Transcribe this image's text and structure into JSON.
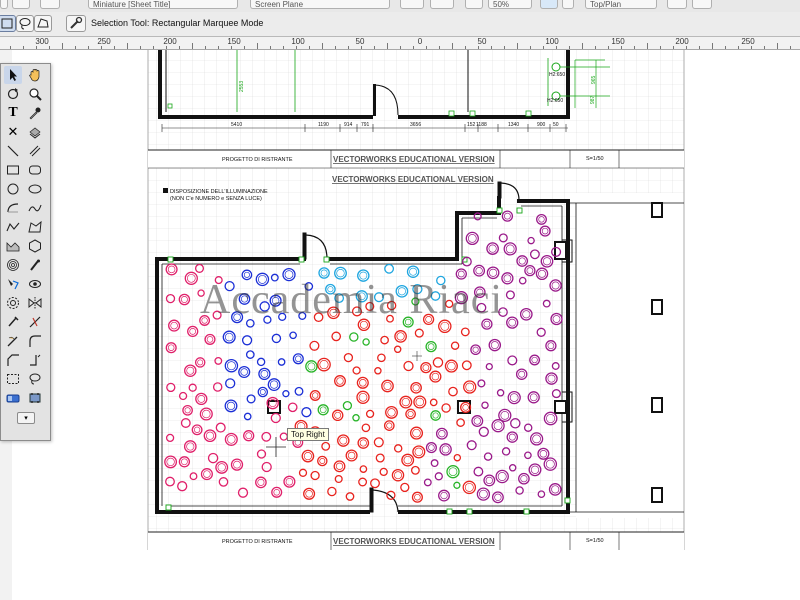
{
  "top_toolbar": {
    "layer_selector": "Miniature [Sheet Title]",
    "plane_selector": "Screen Plane",
    "zoom": "50%",
    "view_selector": "Top/Plan"
  },
  "mode_bar": {
    "tool_hint": "Selection Tool: Rectangular Marquee Mode"
  },
  "ruler": {
    "labels": [
      "300",
      "250",
      "200",
      "150",
      "100",
      "50",
      "0",
      "50",
      "100",
      "150",
      "200",
      "250"
    ]
  },
  "drawing": {
    "upper_dimensions": [
      "5410",
      "1190",
      "914",
      "791",
      "3656",
      "152",
      "1188",
      "1340",
      "900",
      "50"
    ],
    "upper_vertical_dim": "2553",
    "right_dims": [
      "H2:650",
      "965",
      "H2:650",
      "987"
    ],
    "title_block_left": "PROGETTO DI RISTRANTE",
    "title_block_scale": "S=1/50",
    "educational_banner": "VECTORWORKS EDUCATIONAL VERSION",
    "legend_title": "DISPOSIZIONE DELL'ILLUMINAZIONE",
    "legend_subtitle": "(NON C'e NUMERO e SENZA LUCE)",
    "watermark": "Accademia Riaci",
    "tooltip": "Top Right",
    "colors": {
      "pink": "#e0206a",
      "blue": "#1b2fd6",
      "cyan": "#1fa6e0",
      "green": "#28b428",
      "red": "#e8231e",
      "purple": "#9a1a8a",
      "grid": "#d6d6d6"
    }
  },
  "tool_palette": {
    "tools": [
      "selection-arrow-icon",
      "pan-hand-icon",
      "rotate-view-icon",
      "zoom-icon",
      "text-icon",
      "eyedropper-icon",
      "locus-icon",
      "attribute-mapping-icon",
      "line-icon",
      "double-line-icon",
      "rectangle-icon",
      "rounded-rectangle-icon",
      "circle-icon",
      "oval-icon",
      "arc-icon",
      "freehand-icon",
      "polyline-icon",
      "polygon-icon",
      "double-line-polygon-icon",
      "regular-polygon-icon",
      "spiral-icon",
      "visibility-icon",
      "reshape-icon",
      "flyover-icon",
      "offset-icon",
      "mirror-icon",
      "clip-icon",
      "split-icon",
      "trim-icon",
      "fillet-icon",
      "chamfer-icon",
      "connect-icon",
      "marquee-icon",
      "lasso-icon",
      "eraser-icon",
      "dropdown-icon"
    ]
  }
}
